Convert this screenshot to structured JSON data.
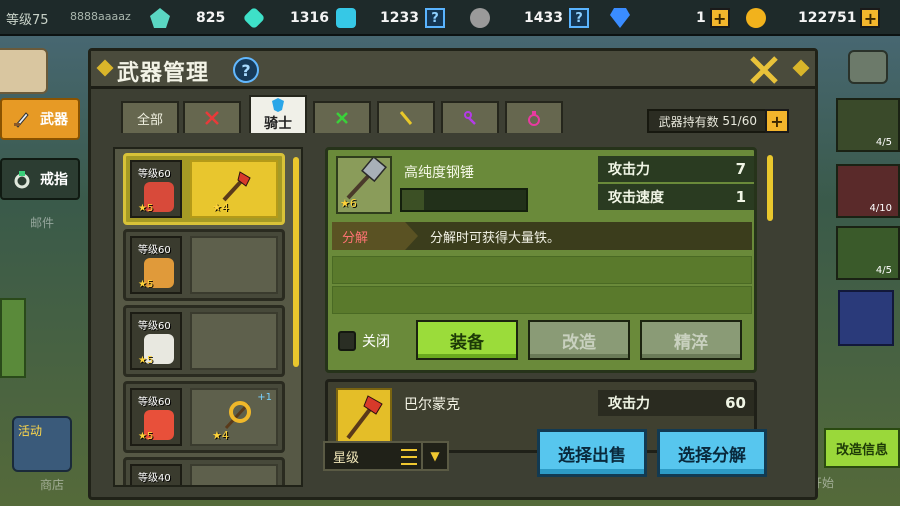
{
  "topbar": {
    "level_label": "等级75",
    "username": "8888aaaaz",
    "resources": [
      {
        "icon": "green-crystal-icon",
        "value": "825",
        "color": "#5ad6c2"
      },
      {
        "icon": "teal-gem-icon",
        "value": "1316",
        "color": "#3ee0c8"
      },
      {
        "icon": "cyan-gem-icon",
        "value": "1233",
        "color": "#36c8e6"
      },
      {
        "icon": "iron-ore-icon",
        "value": "1433",
        "color": "#9a9a9a"
      },
      {
        "icon": "blue-diamond-icon",
        "value": "1",
        "color": "#3a8cff"
      },
      {
        "icon": "gold-coin-icon",
        "value": "122751",
        "color": "#f2b21c"
      }
    ],
    "help_glyph": "?",
    "plus_glyph": "+"
  },
  "sidebar": {
    "weapon_label": "武器",
    "ring_label": "戒指",
    "mail_label": "邮件",
    "shop_label": "商店",
    "event_label": "活动"
  },
  "panel": {
    "title": "武器管理",
    "help_glyph": "?",
    "tabs": [
      {
        "label": "全部"
      },
      {
        "label": "",
        "icon": "red-sword-icon",
        "color": "#e83a3a"
      },
      {
        "label": "骑士",
        "icon": "blue-shield-icon",
        "color": "#2aa6e8"
      },
      {
        "label": "",
        "icon": "green-bow-icon",
        "color": "#3ad03a"
      },
      {
        "label": "",
        "icon": "yellow-staff-icon",
        "color": "#e8c82a"
      },
      {
        "label": "",
        "icon": "purple-wand-icon",
        "color": "#b43ae8"
      },
      {
        "label": "",
        "icon": "pink-potion-icon",
        "color": "#e83aa0"
      }
    ],
    "hold_label": "武器持有数",
    "hold_count": "51/60"
  },
  "cards": [
    {
      "level": "等级60",
      "stars": "★5",
      "weapon_stars": "★4",
      "plus": "",
      "selected": true,
      "face": "#d84a3a"
    },
    {
      "level": "等级60",
      "stars": "★5",
      "weapon_stars": "",
      "plus": "",
      "selected": false,
      "face": "#e09a3a"
    },
    {
      "level": "等级60",
      "stars": "★5",
      "weapon_stars": "",
      "plus": "",
      "selected": false,
      "face": "#e8e8e0"
    },
    {
      "level": "等级60",
      "stars": "★5",
      "weapon_stars": "★4",
      "plus": "+1",
      "selected": false,
      "face": "#e8503a"
    },
    {
      "level": "等级40",
      "stars": "",
      "weapon_stars": "",
      "plus": "",
      "selected": false,
      "face": "#c8a070"
    }
  ],
  "detail": {
    "weapon_name": "高纯度钢锤",
    "weapon_stars": "★6",
    "xp_fill": 0.18,
    "stats": [
      {
        "label": "攻击力",
        "value": "7"
      },
      {
        "label": "攻击速度",
        "value": "1"
      }
    ],
    "tag": "分解",
    "tag_text": "分解时可获得大量铁。",
    "lock_label": "关闭",
    "equip_label": "装备",
    "modify_label": "改造",
    "refine_label": "精淬"
  },
  "detail2": {
    "weapon_name": "巴尔蒙克",
    "stat_label": "攻击力",
    "stat_value": "60"
  },
  "bottom": {
    "sort_label": "星级",
    "sell_label": "选择出售",
    "dismantle_label": "选择分解"
  },
  "right": {
    "counts": [
      "4/5",
      "4/10",
      "4/5"
    ],
    "mod_info_label": "改造信息",
    "adventure_label": "冒险开始"
  }
}
